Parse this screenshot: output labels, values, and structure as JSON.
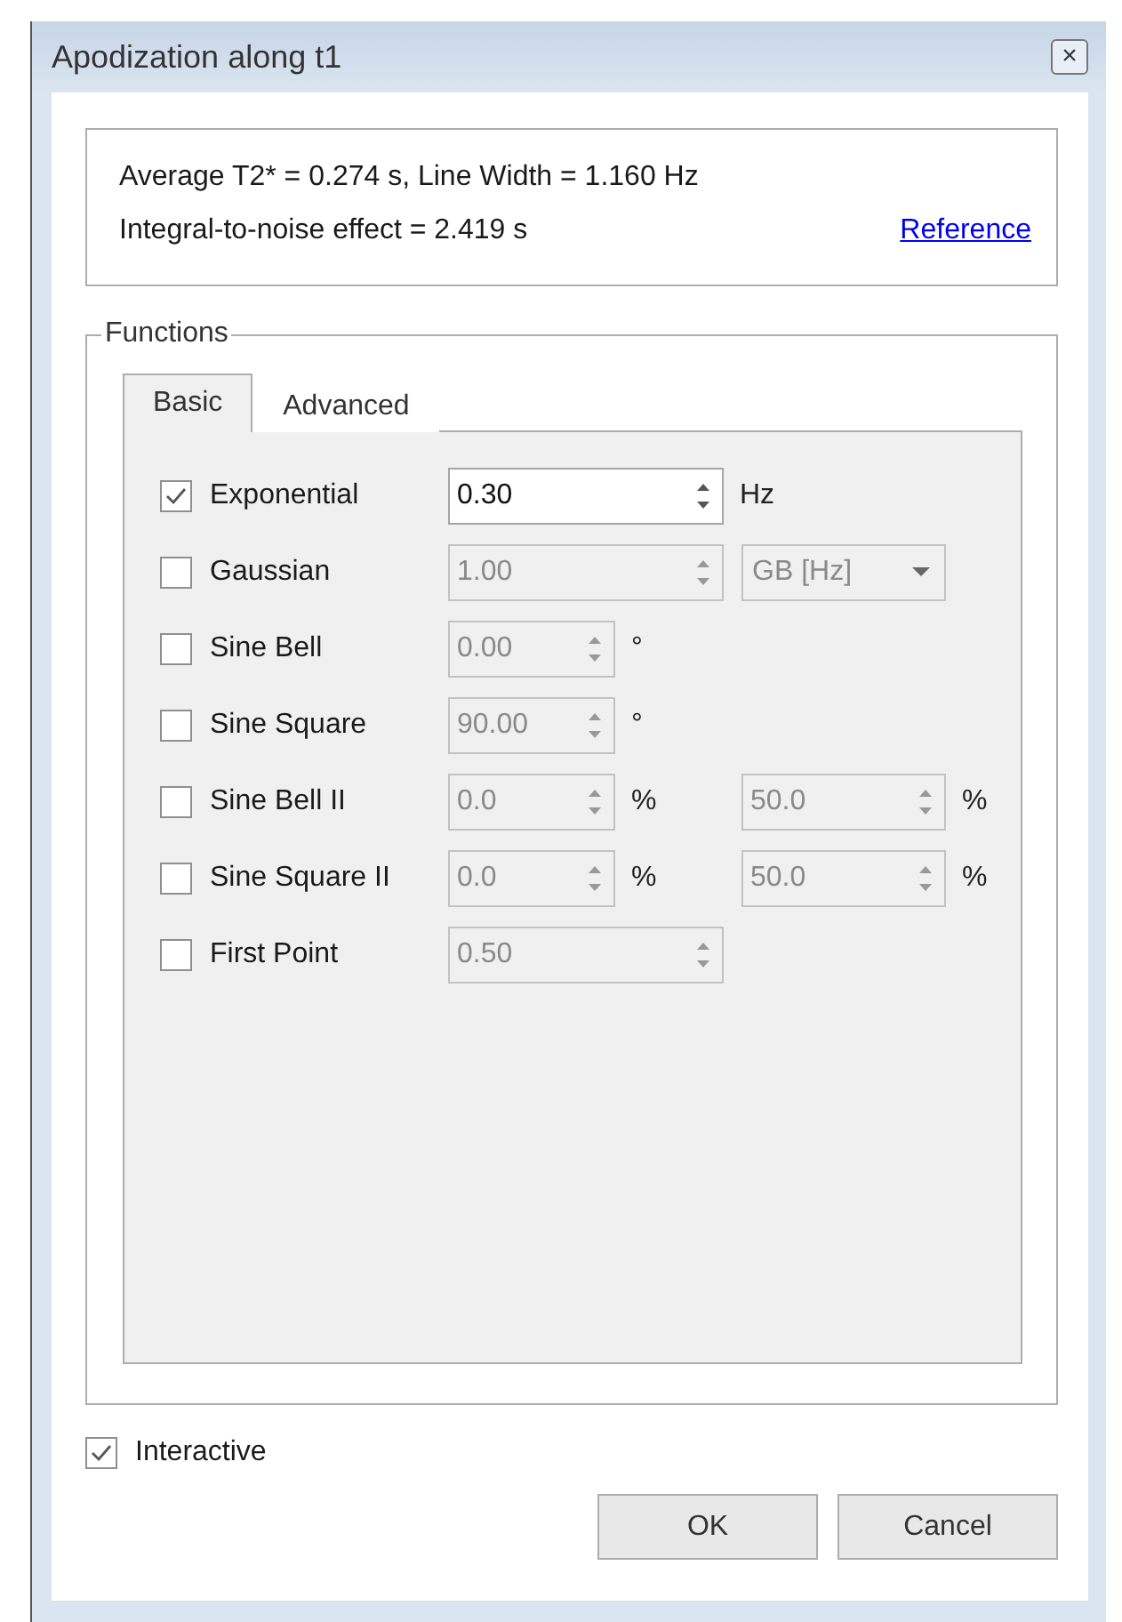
{
  "window": {
    "title": "Apodization along t1",
    "close": "×"
  },
  "info": {
    "lines": [
      "Average T2* = 0.274 s, Line Width = 1.160 Hz",
      "Integral-to-noise effect = 2.419 s"
    ],
    "link": "Reference"
  },
  "functions": {
    "title": "Functions",
    "tabs": [
      {
        "label": "Basic",
        "selected": true
      },
      {
        "label": "Advanced",
        "selected": false
      }
    ],
    "rows": [
      {
        "label": "Exponential",
        "checked": true,
        "controls": [
          {
            "kind": "spin",
            "value": "0.30",
            "disabled": false
          },
          {
            "kind": "unit",
            "text": "Hz"
          }
        ]
      },
      {
        "label": "Gaussian",
        "checked": false,
        "controls": [
          {
            "kind": "spin",
            "value": "1.00",
            "disabled": true
          },
          {
            "kind": "select",
            "value": "GB [Hz]",
            "disabled": true
          }
        ]
      },
      {
        "label": "Sine Bell",
        "checked": false,
        "controls": [
          {
            "kind": "shortspin",
            "value": "0.00",
            "disabled": true
          },
          {
            "kind": "unit",
            "text": "°"
          }
        ]
      },
      {
        "label": "Sine Square",
        "checked": false,
        "controls": [
          {
            "kind": "shortspin",
            "value": "90.00",
            "disabled": true
          },
          {
            "kind": "unit",
            "text": "°"
          }
        ]
      },
      {
        "label": "Sine Bell II",
        "checked": false,
        "controls": [
          {
            "kind": "shortspin",
            "value": "0.0",
            "disabled": true
          },
          {
            "kind": "unit",
            "text": "%"
          },
          {
            "kind": "spin",
            "value": "50.0",
            "disabled": true
          },
          {
            "kind": "unit",
            "text": "%"
          }
        ]
      },
      {
        "label": "Sine Square II",
        "checked": false,
        "controls": [
          {
            "kind": "shortspin",
            "value": "0.0",
            "disabled": true
          },
          {
            "kind": "unit",
            "text": "%"
          },
          {
            "kind": "spin",
            "value": "50.0",
            "disabled": true
          },
          {
            "kind": "unit",
            "text": "%"
          }
        ]
      },
      {
        "label": "First Point",
        "checked": false,
        "controls": [
          {
            "kind": "spin",
            "value": "0.50",
            "disabled": true
          }
        ]
      }
    ]
  },
  "interactive": {
    "label": "Interactive",
    "checked": true
  },
  "buttons": [
    "OK",
    "Cancel"
  ]
}
